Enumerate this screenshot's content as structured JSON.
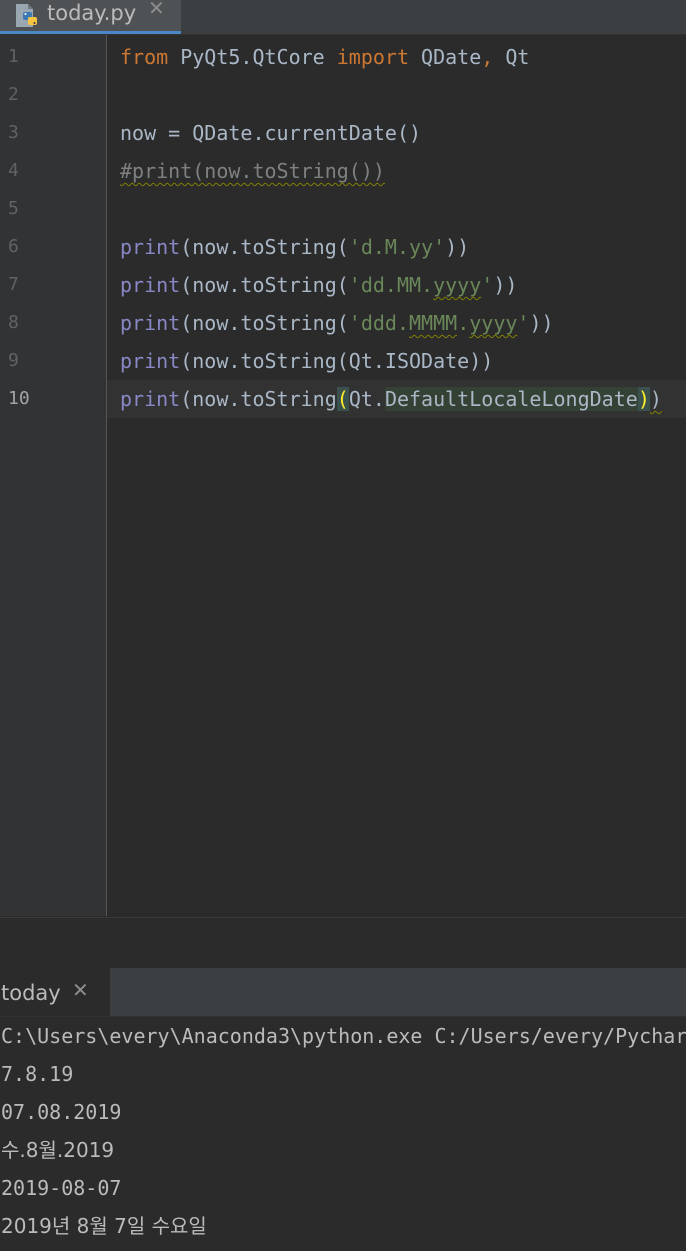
{
  "editor_tab": {
    "filename": "today.py",
    "close_glyph": "✕",
    "icon": "python-file-icon"
  },
  "gutter": {
    "line_numbers": [
      "1",
      "2",
      "3",
      "4",
      "5",
      "6",
      "7",
      "8",
      "9",
      "10"
    ],
    "current_line": "10"
  },
  "code": {
    "l1": {
      "kw1": "from",
      "module": " PyQt5.QtCore ",
      "kw2": "import",
      "names": " QDate",
      "comma": ",",
      "name2": " Qt"
    },
    "l3": {
      "text": "now = QDate.currentDate()"
    },
    "l4": {
      "comment": "#print(now.toString())"
    },
    "l6": {
      "print": "print",
      "call": "(now.toString(",
      "q1": "'",
      "fmt": "d.M.yy",
      "q2": "'",
      "close": "))"
    },
    "l7": {
      "print": "print",
      "call": "(now.toString(",
      "q1": "'",
      "fmt_a": "dd.MM.",
      "fmt_b": "yyyy",
      "q2": "'",
      "close": "))"
    },
    "l8": {
      "print": "print",
      "call": "(now.toString(",
      "q1": "'",
      "fmt_a": "ddd.",
      "fmt_b": "MMMM",
      "fmt_c": ".",
      "fmt_d": "yyyy",
      "q2": "'",
      "close": "))"
    },
    "l9": {
      "print": "print",
      "call": "(now.toString(Qt.ISODate))"
    },
    "l10": {
      "print": "print",
      "call": "(now.toString",
      "open": "(",
      "qt": "Qt.",
      "attr": "DefaultLocaleLongDate",
      "close_inner": ")",
      "close_outer": ")"
    }
  },
  "run_panel": {
    "tab_label": "today",
    "close_glyph": "✕",
    "output": [
      "C:\\Users\\every\\Anaconda3\\python.exe C:/Users/every/Pychar",
      "7.8.19",
      "07.08.2019",
      "수.8월.2019",
      "2019-08-07",
      "2019년 8월 7일 수요일"
    ]
  },
  "colors": {
    "background": "#2b2b2b",
    "keyword": "#cc7832",
    "builtin": "#8888c6",
    "string": "#6a8759",
    "comment": "#808080",
    "text": "#a9b7c6",
    "brace_match": "#ffef28",
    "tab_accent": "#4a88c7"
  }
}
